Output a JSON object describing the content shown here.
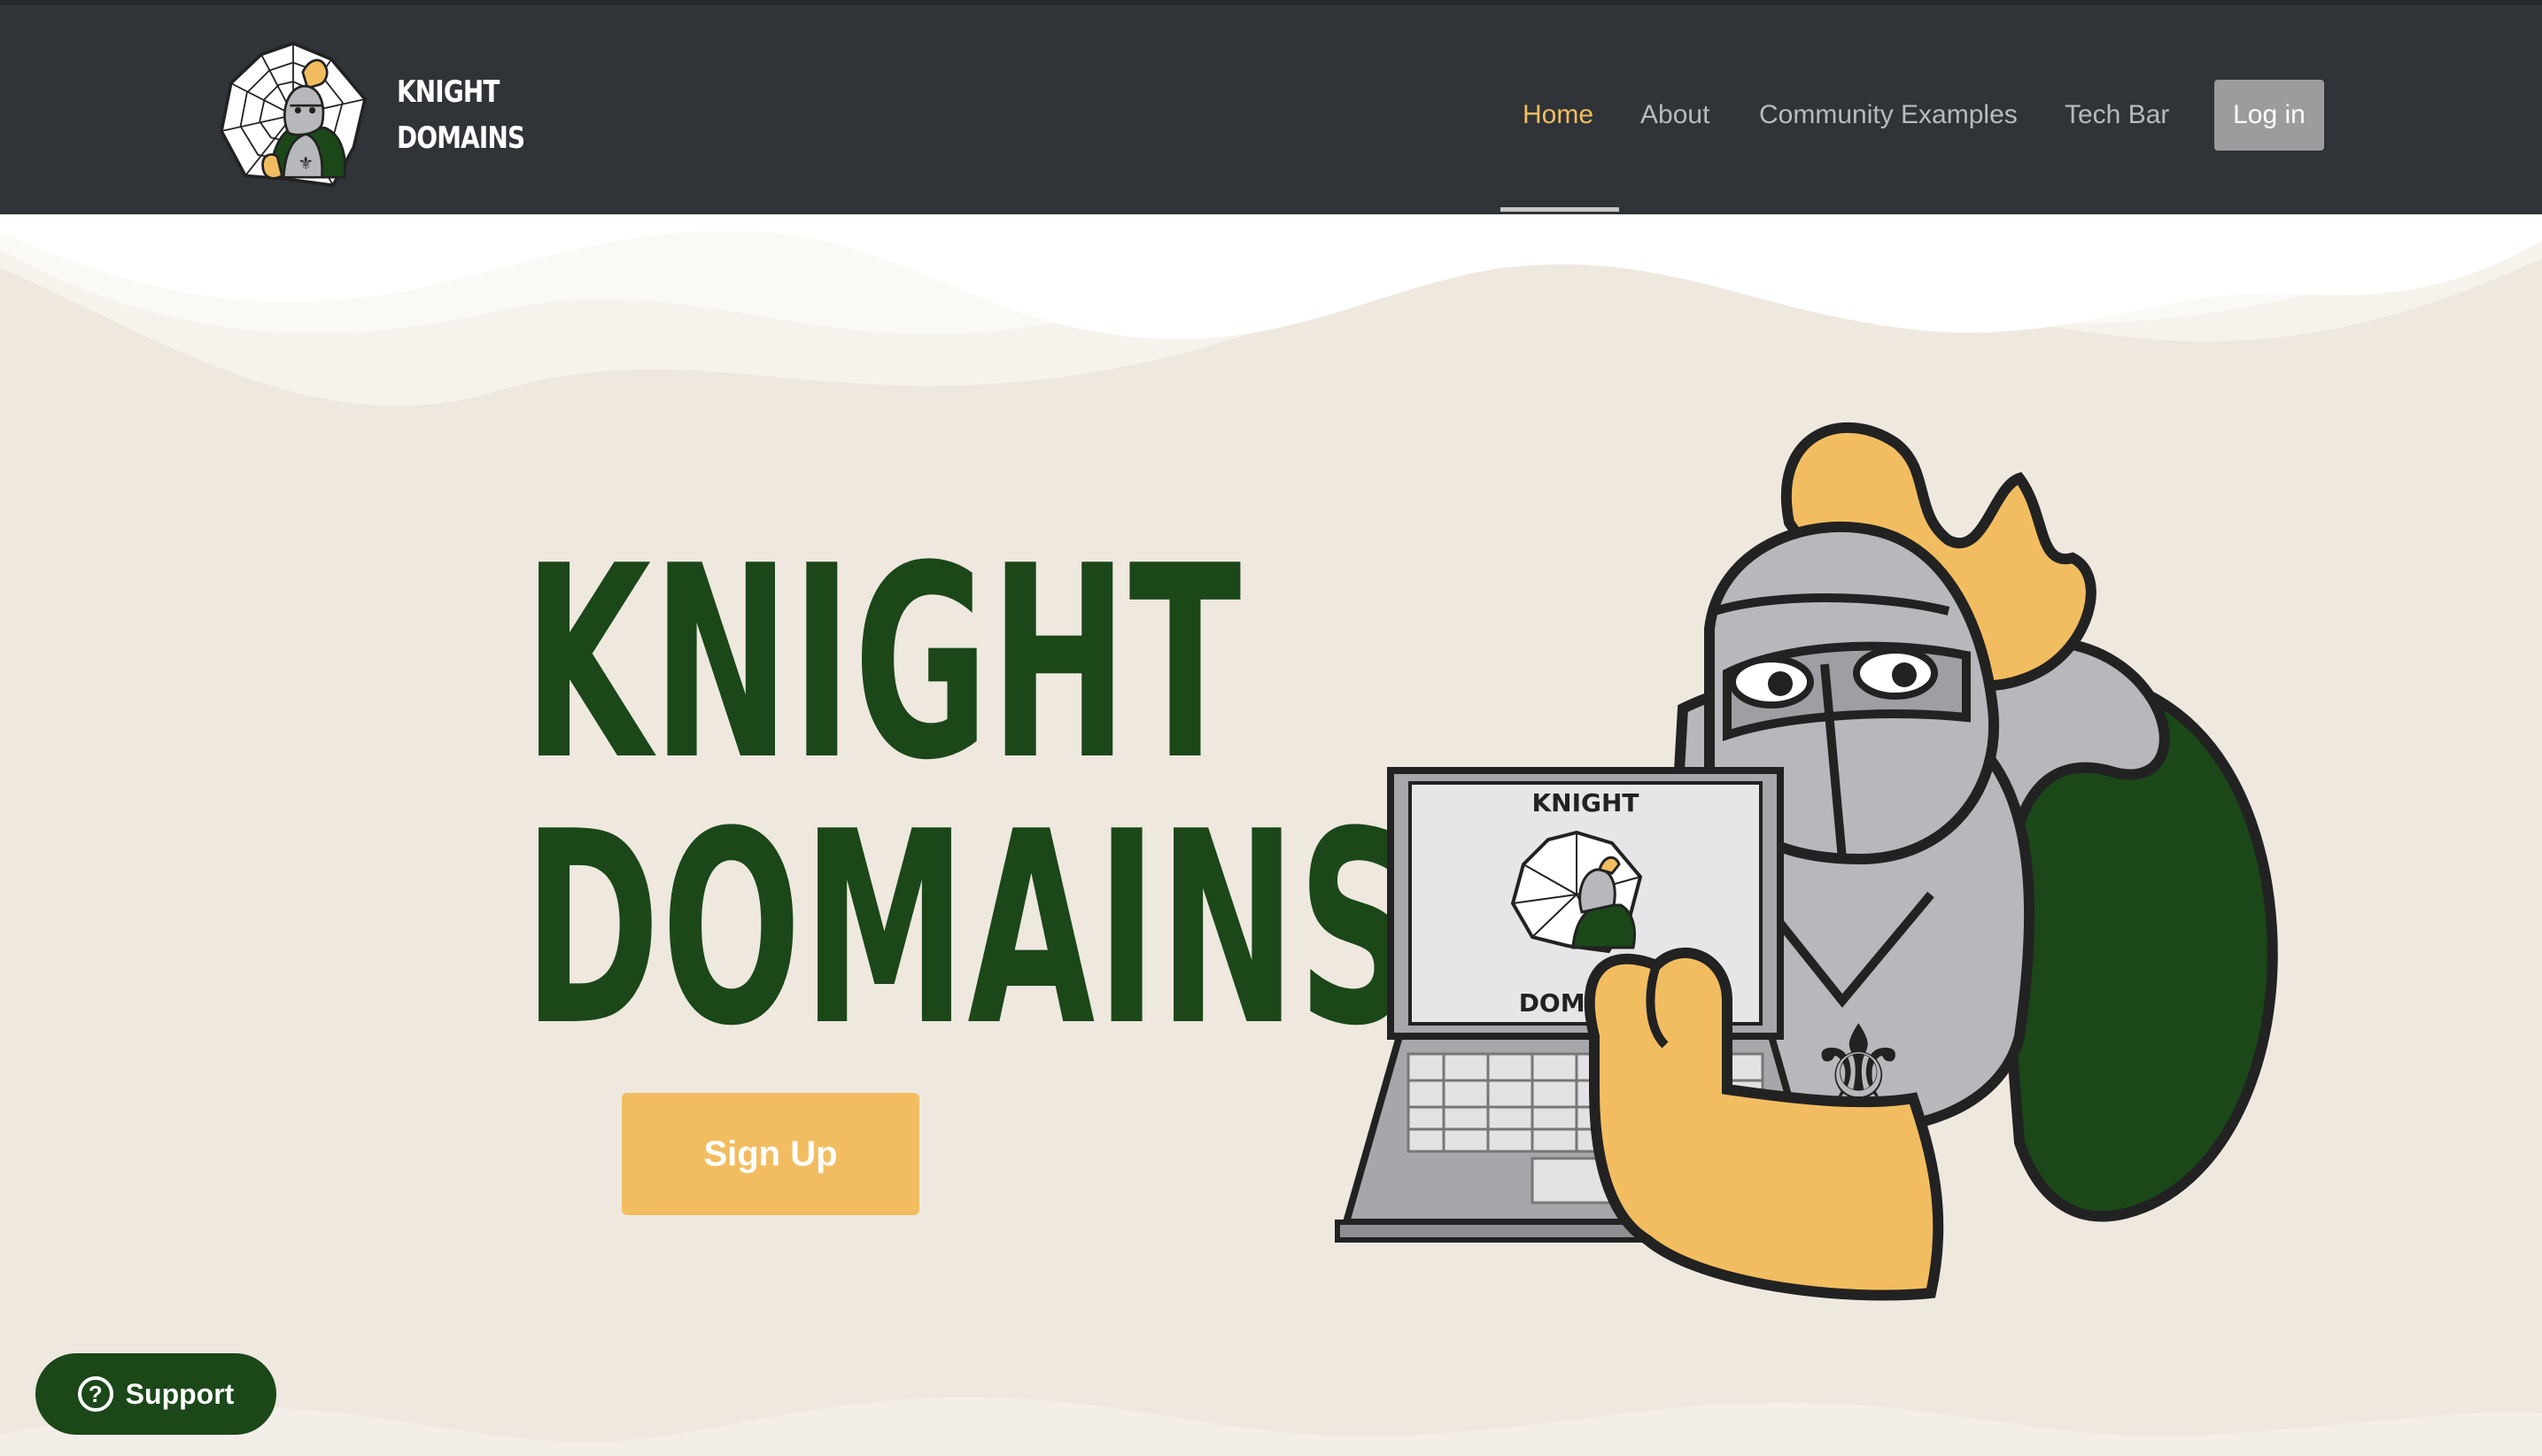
{
  "header": {
    "brand": {
      "line1": "KNIGHT",
      "line2": "DOMAINS"
    },
    "nav": [
      {
        "label": "Home",
        "active": true
      },
      {
        "label": "About",
        "active": false
      },
      {
        "label": "Community Examples",
        "active": false
      },
      {
        "label": "Tech Bar",
        "active": false
      }
    ],
    "login_label": "Log in"
  },
  "hero": {
    "title_line1": "KNIGHT",
    "title_line2": "DOMAINS",
    "signup_label": "Sign Up",
    "laptop_screen": {
      "line1": "KNIGHT",
      "line2": "DOMAINS"
    }
  },
  "support": {
    "icon": "?",
    "label": "Support"
  },
  "colors": {
    "header_bg": "#303338",
    "page_bg": "#eee8df",
    "brand_green": "#1b4719",
    "accent_gold": "#f2bd60",
    "nav_text": "#b9babc",
    "login_bg": "#9c9c9e",
    "armor_gray": "#b7b8bb"
  },
  "icons": {
    "logo": "knight-spiderweb-logo-icon",
    "support": "question-circle-icon",
    "mascot": "knight-mascot-illustration"
  }
}
